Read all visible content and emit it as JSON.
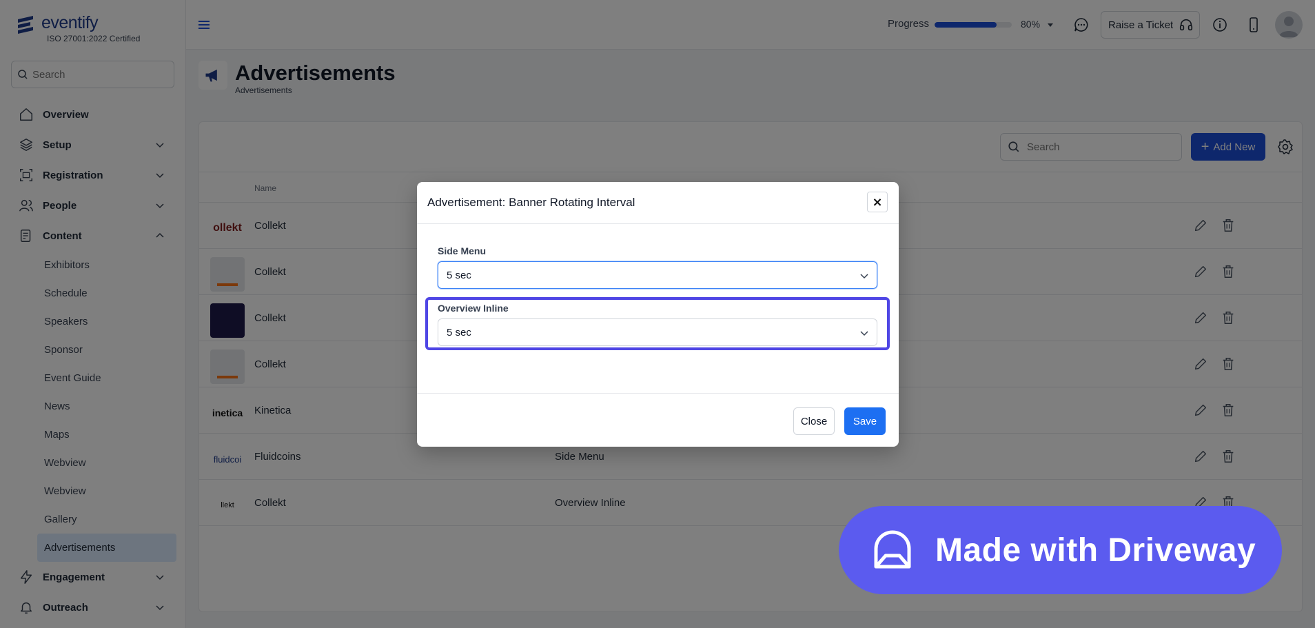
{
  "brand": {
    "name": "eventify",
    "certification": "ISO 27001:2022 Certified",
    "color": "#1e3a8a"
  },
  "sidebar": {
    "search_placeholder": "Search",
    "items": [
      {
        "label": "Overview",
        "icon": "home-icon"
      },
      {
        "label": "Setup",
        "icon": "layers-icon"
      },
      {
        "label": "Registration",
        "icon": "registration-icon"
      },
      {
        "label": "People",
        "icon": "people-icon"
      },
      {
        "label": "Content",
        "icon": "content-icon"
      }
    ],
    "content_subitems": [
      "Exhibitors",
      "Schedule",
      "Speakers",
      "Sponsor",
      "Event Guide",
      "News",
      "Maps",
      "Webview",
      "Webview",
      "Gallery",
      "Advertisements"
    ],
    "bottom_items": [
      {
        "label": "Engagement",
        "icon": "lightning-icon"
      },
      {
        "label": "Outreach",
        "icon": "bell-icon"
      }
    ]
  },
  "topbar": {
    "progress_label": "Progress",
    "progress_value": "80%",
    "progress_fraction": 0.8,
    "ticket_label": "Raise a Ticket"
  },
  "page": {
    "title": "Advertisements",
    "breadcrumb": "Advertisements"
  },
  "card": {
    "search_placeholder": "Search",
    "add_label": "Add New",
    "column_name": "Name",
    "rows": [
      {
        "name": "Collekt",
        "placement": ""
      },
      {
        "name": "Collekt",
        "placement": ""
      },
      {
        "name": "Collekt",
        "placement": ""
      },
      {
        "name": "Collekt",
        "placement": ""
      },
      {
        "name": "Kinetica",
        "placement": ""
      },
      {
        "name": "Fluidcoins",
        "placement": "Side Menu"
      },
      {
        "name": "Collekt",
        "placement": "Overview Inline"
      }
    ]
  },
  "modal": {
    "title": "Advertisement: Banner Rotating Interval",
    "close_x": "×",
    "fields": [
      {
        "label": "Side Menu",
        "value": "5 sec"
      },
      {
        "label": "Overview Inline",
        "value": "5 sec"
      }
    ],
    "close_label": "Close",
    "save_label": "Save"
  },
  "badge": {
    "text": "Made with Driveway",
    "color": "#5b5bef"
  },
  "colors": {
    "primary": "#1d4ed8",
    "highlight": "#4f46e5"
  }
}
